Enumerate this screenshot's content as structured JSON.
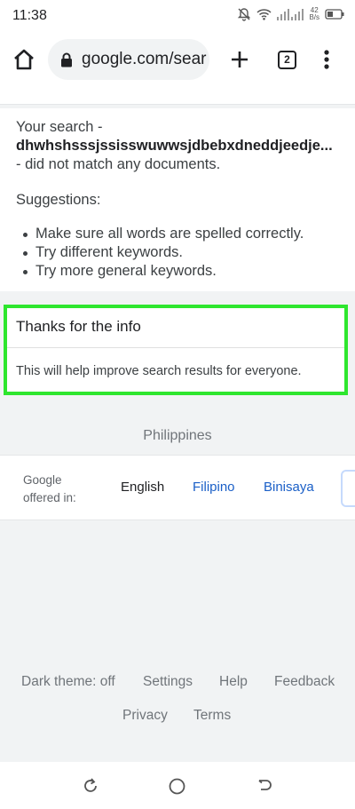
{
  "status_bar": {
    "time": "11:38",
    "speed_top": "42",
    "speed_bottom": "B/s"
  },
  "toolbar": {
    "url": "google.com/sear",
    "tab_count": "2"
  },
  "result": {
    "line1": "Your search -",
    "query": "dhwhshsssjssisswuwwsjdbebxdneddjeedje...",
    "line3": "- did not match any documents.",
    "suggestions_heading": "Suggestions:",
    "suggestions": [
      "Make sure all words are spelled correctly.",
      "Try different keywords.",
      "Try more general keywords."
    ]
  },
  "feedback": {
    "title": "Thanks for the info",
    "body": "This will help improve search results for everyone.",
    "highlight_color": "#2ee62e"
  },
  "location": "Philippines",
  "languages": {
    "offered_line1": "Google",
    "offered_line2": "offered in:",
    "current": "English",
    "others": [
      "Filipino",
      "Binisaya"
    ],
    "link_color": "#1a5fc7"
  },
  "footer": {
    "dark_theme": "Dark theme: off",
    "settings": "Settings",
    "help": "Help",
    "feedback": "Feedback",
    "privacy": "Privacy",
    "terms": "Terms"
  },
  "icons": [
    "mute-bell-icon",
    "wifi-icon",
    "signal-icon",
    "battery-icon",
    "home-icon",
    "lock-icon",
    "plus-icon",
    "more-vert-icon",
    "recents-icon",
    "home-circle-icon",
    "back-icon"
  ]
}
